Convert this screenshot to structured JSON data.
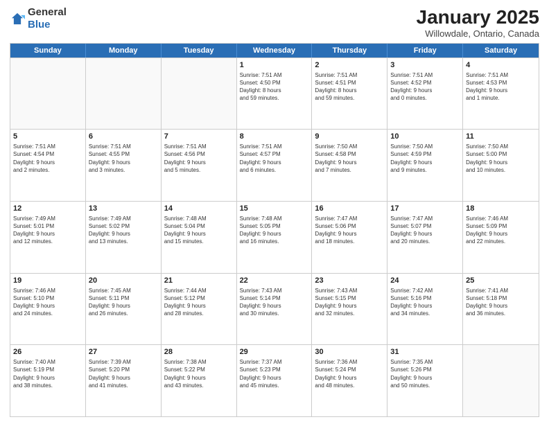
{
  "logo": {
    "general": "General",
    "blue": "Blue"
  },
  "title": "January 2025",
  "subtitle": "Willowdale, Ontario, Canada",
  "weekdays": [
    "Sunday",
    "Monday",
    "Tuesday",
    "Wednesday",
    "Thursday",
    "Friday",
    "Saturday"
  ],
  "rows": [
    [
      {
        "date": "",
        "info": ""
      },
      {
        "date": "",
        "info": ""
      },
      {
        "date": "",
        "info": ""
      },
      {
        "date": "1",
        "info": "Sunrise: 7:51 AM\nSunset: 4:50 PM\nDaylight: 8 hours\nand 59 minutes."
      },
      {
        "date": "2",
        "info": "Sunrise: 7:51 AM\nSunset: 4:51 PM\nDaylight: 8 hours\nand 59 minutes."
      },
      {
        "date": "3",
        "info": "Sunrise: 7:51 AM\nSunset: 4:52 PM\nDaylight: 9 hours\nand 0 minutes."
      },
      {
        "date": "4",
        "info": "Sunrise: 7:51 AM\nSunset: 4:53 PM\nDaylight: 9 hours\nand 1 minute."
      }
    ],
    [
      {
        "date": "5",
        "info": "Sunrise: 7:51 AM\nSunset: 4:54 PM\nDaylight: 9 hours\nand 2 minutes."
      },
      {
        "date": "6",
        "info": "Sunrise: 7:51 AM\nSunset: 4:55 PM\nDaylight: 9 hours\nand 3 minutes."
      },
      {
        "date": "7",
        "info": "Sunrise: 7:51 AM\nSunset: 4:56 PM\nDaylight: 9 hours\nand 5 minutes."
      },
      {
        "date": "8",
        "info": "Sunrise: 7:51 AM\nSunset: 4:57 PM\nDaylight: 9 hours\nand 6 minutes."
      },
      {
        "date": "9",
        "info": "Sunrise: 7:50 AM\nSunset: 4:58 PM\nDaylight: 9 hours\nand 7 minutes."
      },
      {
        "date": "10",
        "info": "Sunrise: 7:50 AM\nSunset: 4:59 PM\nDaylight: 9 hours\nand 9 minutes."
      },
      {
        "date": "11",
        "info": "Sunrise: 7:50 AM\nSunset: 5:00 PM\nDaylight: 9 hours\nand 10 minutes."
      }
    ],
    [
      {
        "date": "12",
        "info": "Sunrise: 7:49 AM\nSunset: 5:01 PM\nDaylight: 9 hours\nand 12 minutes."
      },
      {
        "date": "13",
        "info": "Sunrise: 7:49 AM\nSunset: 5:02 PM\nDaylight: 9 hours\nand 13 minutes."
      },
      {
        "date": "14",
        "info": "Sunrise: 7:48 AM\nSunset: 5:04 PM\nDaylight: 9 hours\nand 15 minutes."
      },
      {
        "date": "15",
        "info": "Sunrise: 7:48 AM\nSunset: 5:05 PM\nDaylight: 9 hours\nand 16 minutes."
      },
      {
        "date": "16",
        "info": "Sunrise: 7:47 AM\nSunset: 5:06 PM\nDaylight: 9 hours\nand 18 minutes."
      },
      {
        "date": "17",
        "info": "Sunrise: 7:47 AM\nSunset: 5:07 PM\nDaylight: 9 hours\nand 20 minutes."
      },
      {
        "date": "18",
        "info": "Sunrise: 7:46 AM\nSunset: 5:09 PM\nDaylight: 9 hours\nand 22 minutes."
      }
    ],
    [
      {
        "date": "19",
        "info": "Sunrise: 7:46 AM\nSunset: 5:10 PM\nDaylight: 9 hours\nand 24 minutes."
      },
      {
        "date": "20",
        "info": "Sunrise: 7:45 AM\nSunset: 5:11 PM\nDaylight: 9 hours\nand 26 minutes."
      },
      {
        "date": "21",
        "info": "Sunrise: 7:44 AM\nSunset: 5:12 PM\nDaylight: 9 hours\nand 28 minutes."
      },
      {
        "date": "22",
        "info": "Sunrise: 7:43 AM\nSunset: 5:14 PM\nDaylight: 9 hours\nand 30 minutes."
      },
      {
        "date": "23",
        "info": "Sunrise: 7:43 AM\nSunset: 5:15 PM\nDaylight: 9 hours\nand 32 minutes."
      },
      {
        "date": "24",
        "info": "Sunrise: 7:42 AM\nSunset: 5:16 PM\nDaylight: 9 hours\nand 34 minutes."
      },
      {
        "date": "25",
        "info": "Sunrise: 7:41 AM\nSunset: 5:18 PM\nDaylight: 9 hours\nand 36 minutes."
      }
    ],
    [
      {
        "date": "26",
        "info": "Sunrise: 7:40 AM\nSunset: 5:19 PM\nDaylight: 9 hours\nand 38 minutes."
      },
      {
        "date": "27",
        "info": "Sunrise: 7:39 AM\nSunset: 5:20 PM\nDaylight: 9 hours\nand 41 minutes."
      },
      {
        "date": "28",
        "info": "Sunrise: 7:38 AM\nSunset: 5:22 PM\nDaylight: 9 hours\nand 43 minutes."
      },
      {
        "date": "29",
        "info": "Sunrise: 7:37 AM\nSunset: 5:23 PM\nDaylight: 9 hours\nand 45 minutes."
      },
      {
        "date": "30",
        "info": "Sunrise: 7:36 AM\nSunset: 5:24 PM\nDaylight: 9 hours\nand 48 minutes."
      },
      {
        "date": "31",
        "info": "Sunrise: 7:35 AM\nSunset: 5:26 PM\nDaylight: 9 hours\nand 50 minutes."
      },
      {
        "date": "",
        "info": ""
      }
    ]
  ]
}
